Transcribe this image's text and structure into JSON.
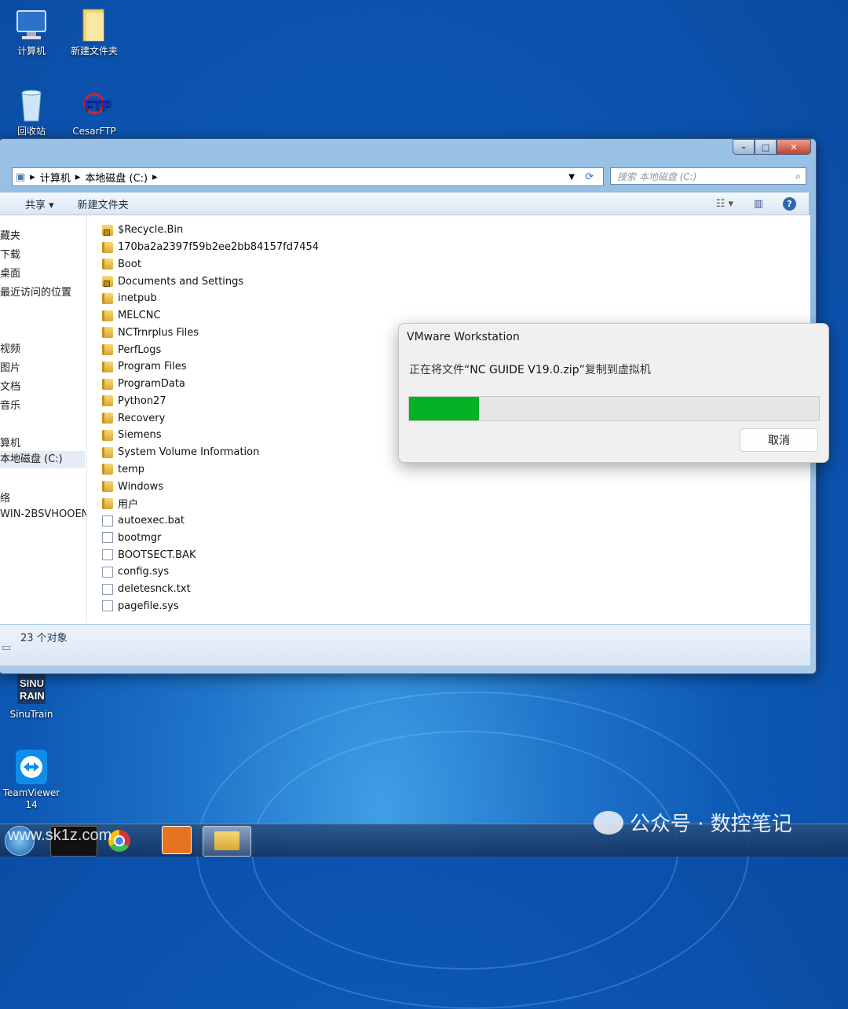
{
  "desktop": {
    "icons": [
      {
        "label": "计算机",
        "icon": "computer-icon"
      },
      {
        "label": "新建文件夹",
        "icon": "folder-icon"
      },
      {
        "label": "回收站",
        "icon": "recycle-bin-icon"
      },
      {
        "label": "CesarFTP",
        "icon": "ftp-icon"
      },
      {
        "label": "SinuTrain",
        "icon": "sinutrain-icon"
      },
      {
        "label": "TeamViewer 14",
        "icon": "teamviewer-icon"
      }
    ]
  },
  "explorer": {
    "window_controls": {
      "minimize": "–",
      "maximize": "□",
      "close": "✕"
    },
    "address": {
      "parts": [
        "计算机",
        "本地磁盘 (C:)"
      ],
      "sep": "▸"
    },
    "search_placeholder": "搜索 本地磁盘 (C:)",
    "toolbar": {
      "share": "共享 ▾",
      "new_folder": "新建文件夹"
    },
    "nav": [
      "藏夹",
      "下载",
      "桌面",
      "最近访问的位置",
      "视频",
      "图片",
      "文档",
      "音乐",
      "算机",
      "本地磁盘 (C:)",
      "络",
      "WIN-2BSVHOOEN"
    ],
    "files": [
      {
        "name": "$Recycle.Bin",
        "type": "lockfolder"
      },
      {
        "name": "170ba2a2397f59b2ee2bb84157fd7454",
        "type": "folder"
      },
      {
        "name": "Boot",
        "type": "folder"
      },
      {
        "name": "Documents and Settings",
        "type": "lockfolder"
      },
      {
        "name": "inetpub",
        "type": "folder"
      },
      {
        "name": "MELCNC",
        "type": "folder"
      },
      {
        "name": "NCTrnrplus Files",
        "type": "folder"
      },
      {
        "name": "PerfLogs",
        "type": "folder"
      },
      {
        "name": "Program Files",
        "type": "folder"
      },
      {
        "name": "ProgramData",
        "type": "folder"
      },
      {
        "name": "Python27",
        "type": "folder"
      },
      {
        "name": "Recovery",
        "type": "folder"
      },
      {
        "name": "Siemens",
        "type": "folder"
      },
      {
        "name": "System Volume Information",
        "type": "folder"
      },
      {
        "name": "temp",
        "type": "folder"
      },
      {
        "name": "Windows",
        "type": "folder"
      },
      {
        "name": "用户",
        "type": "folder"
      },
      {
        "name": "autoexec.bat",
        "type": "doc"
      },
      {
        "name": "bootmgr",
        "type": "doc"
      },
      {
        "name": "BOOTSECT.BAK",
        "type": "doc"
      },
      {
        "name": "config.sys",
        "type": "doc"
      },
      {
        "name": "deletesnck.txt",
        "type": "doc"
      },
      {
        "name": "pagefile.sys",
        "type": "doc"
      }
    ],
    "status": "23 个对象"
  },
  "dialog": {
    "title": "VMware Workstation",
    "message_prefix": "正在将文件",
    "filename": "“NC GUIDE V19.0.zip”",
    "message_suffix": "复制到虚拟机",
    "progress": 0.17,
    "progress_color": "#06b025",
    "cancel": "取消"
  },
  "watermark": {
    "left": "www.sk1z.com",
    "right": "公众号 · 数控笔记"
  }
}
